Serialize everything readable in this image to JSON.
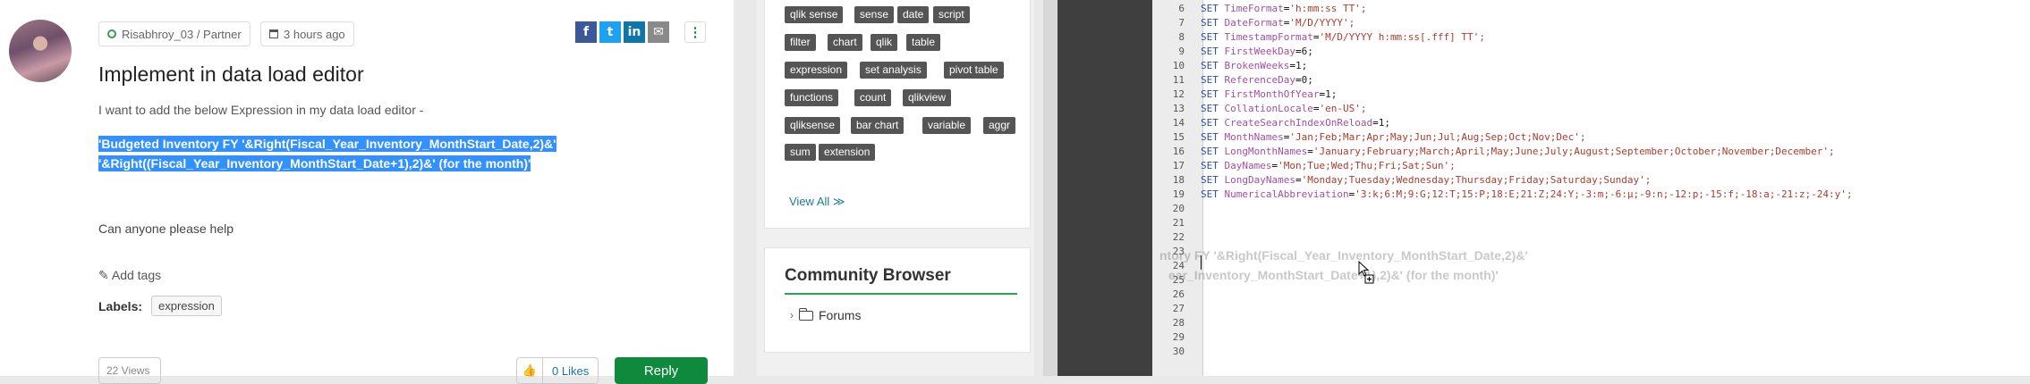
{
  "post": {
    "author": "Risabhroy_03 / Partner",
    "time": "3 hours ago",
    "title": "Implement in data load editor",
    "intro": "I want to add the below Expression in my data load editor -",
    "expression_line1": "'Budgeted Inventory FY '&Right(Fiscal_Year_Inventory_MonthStart_Date,2)&'",
    "expression_line2": "'&Right((Fiscal_Year_Inventory_MonthStart_Date+1),2)&' (for the month)'",
    "help": "Can anyone please help",
    "add_tags": "Add tags",
    "labels_label": "Labels:",
    "label_chip": "expression",
    "views": "22 Views",
    "likes": "0 Likes",
    "reply": "Reply",
    "share": {
      "facebook": "f",
      "twitter": "t",
      "linkedin": "in",
      "email": "✉"
    },
    "kebab": "⋮"
  },
  "sidebar": {
    "tags": [
      "qlik sense",
      "sense",
      "date",
      "script",
      "filter",
      "chart",
      "qlik",
      "table",
      "expression",
      "set analysis",
      "pivot table",
      "functions",
      "count",
      "qlikview",
      "qliksense",
      "bar chart",
      "variable",
      "aggr",
      "sum",
      "extension"
    ],
    "view_all": "View All ≫",
    "community_browser": "Community Browser",
    "forums": "Forums"
  },
  "editor": {
    "lines": [
      {
        "n": "6",
        "kw": "SET",
        "var": "TimeFormat",
        "val": "'h:mm:ss TT';"
      },
      {
        "n": "7",
        "kw": "SET",
        "var": "DateFormat",
        "val": "'M/D/YYYY';"
      },
      {
        "n": "8",
        "kw": "SET",
        "var": "TimestampFormat",
        "val": "'M/D/YYYY h:mm:ss[.fff] TT';"
      },
      {
        "n": "9",
        "kw": "SET",
        "var": "FirstWeekDay",
        "val": "6;"
      },
      {
        "n": "10",
        "kw": "SET",
        "var": "BrokenWeeks",
        "val": "1;"
      },
      {
        "n": "11",
        "kw": "SET",
        "var": "ReferenceDay",
        "val": "0;"
      },
      {
        "n": "12",
        "kw": "SET",
        "var": "FirstMonthOfYear",
        "val": "1;"
      },
      {
        "n": "13",
        "kw": "SET",
        "var": "CollationLocale",
        "val": "'en-US';"
      },
      {
        "n": "14",
        "kw": "SET",
        "var": "CreateSearchIndexOnReload",
        "val": "1;"
      },
      {
        "n": "15",
        "kw": "SET",
        "var": "MonthNames",
        "val": "'Jan;Feb;Mar;Apr;May;Jun;Jul;Aug;Sep;Oct;Nov;Dec';"
      },
      {
        "n": "16",
        "kw": "SET",
        "var": "LongMonthNames",
        "val": "'January;February;March;April;May;June;July;August;September;October;November;December';"
      },
      {
        "n": "17",
        "kw": "SET",
        "var": "DayNames",
        "val": "'Mon;Tue;Wed;Thu;Fri;Sat;Sun';"
      },
      {
        "n": "18",
        "kw": "SET",
        "var": "LongDayNames",
        "val": "'Monday;Tuesday;Wednesday;Thursday;Friday;Saturday;Sunday';"
      },
      {
        "n": "19",
        "kw": "SET",
        "var": "NumericalAbbreviation",
        "val": "'3:k;6:M;9:G;12:T;15:P;18:E;21:Z;24:Y;-3:m;-6:μ;-9:n;-12:p;-15:f;-18:a;-21:z;-24:y';"
      },
      {
        "n": "20"
      },
      {
        "n": "21"
      },
      {
        "n": "22"
      },
      {
        "n": "23"
      },
      {
        "n": "24"
      },
      {
        "n": "25"
      },
      {
        "n": "26"
      },
      {
        "n": "27"
      },
      {
        "n": "28"
      },
      {
        "n": "29"
      },
      {
        "n": "30"
      }
    ],
    "ghost_line1": "ntory FY '&Right(Fiscal_Year_Inventory_MonthStart_Date,2)&'",
    "ghost_line2": "ear_Inventory_MonthStart_Date+1),2)&' (for the month)'"
  },
  "colors": {
    "selection": "#3390ff",
    "reply_button": "#0f8a3c",
    "tag_bg": "#555555",
    "keyword": "#2d4fa0",
    "variable": "#a24ea6",
    "string": "#b03a2e"
  }
}
